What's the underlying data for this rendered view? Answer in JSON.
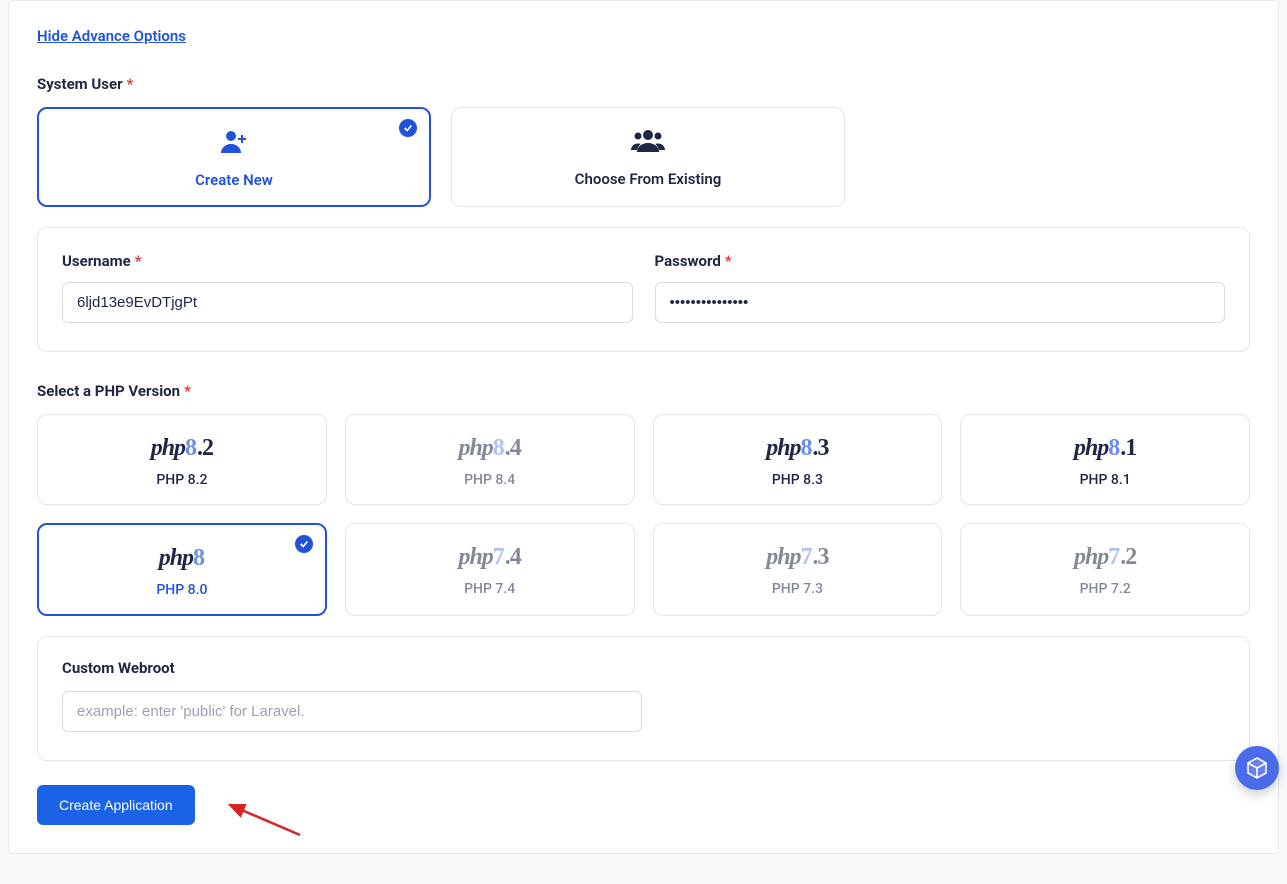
{
  "advance_toggle": "Hide Advance Options",
  "system_user": {
    "label": "System User",
    "create_new": "Create New",
    "choose_existing": "Choose From Existing",
    "selected": "create_new"
  },
  "username": {
    "label": "Username",
    "value": "6ljd13e9EvDTjgPt"
  },
  "password": {
    "label": "Password",
    "value": "•••••••••••••••"
  },
  "php_section": {
    "label": "Select a PHP Version",
    "selected": "PHP 8.0",
    "versions": [
      {
        "logo_prefix": "php",
        "logo_digit": "8",
        "logo_suffix": ".2",
        "label": "PHP 8.2",
        "dimmed": false
      },
      {
        "logo_prefix": "php",
        "logo_digit": "8",
        "logo_suffix": ".4",
        "label": "PHP 8.4",
        "dimmed": true
      },
      {
        "logo_prefix": "php",
        "logo_digit": "8",
        "logo_suffix": ".3",
        "label": "PHP 8.3",
        "dimmed": false
      },
      {
        "logo_prefix": "php",
        "logo_digit": "8",
        "logo_suffix": ".1",
        "label": "PHP 8.1",
        "dimmed": false
      },
      {
        "logo_prefix": "php",
        "logo_digit": "8",
        "logo_suffix": "",
        "label": "PHP 8.0",
        "dimmed": false
      },
      {
        "logo_prefix": "php",
        "logo_digit": "7",
        "logo_suffix": ".4",
        "label": "PHP 7.4",
        "dimmed": true
      },
      {
        "logo_prefix": "php",
        "logo_digit": "7",
        "logo_suffix": ".3",
        "label": "PHP 7.3",
        "dimmed": true
      },
      {
        "logo_prefix": "php",
        "logo_digit": "7",
        "logo_suffix": ".2",
        "label": "PHP 7.2",
        "dimmed": true
      }
    ]
  },
  "webroot": {
    "label": "Custom Webroot",
    "placeholder": "example: enter 'public' for Laravel."
  },
  "submit_label": "Create Application"
}
